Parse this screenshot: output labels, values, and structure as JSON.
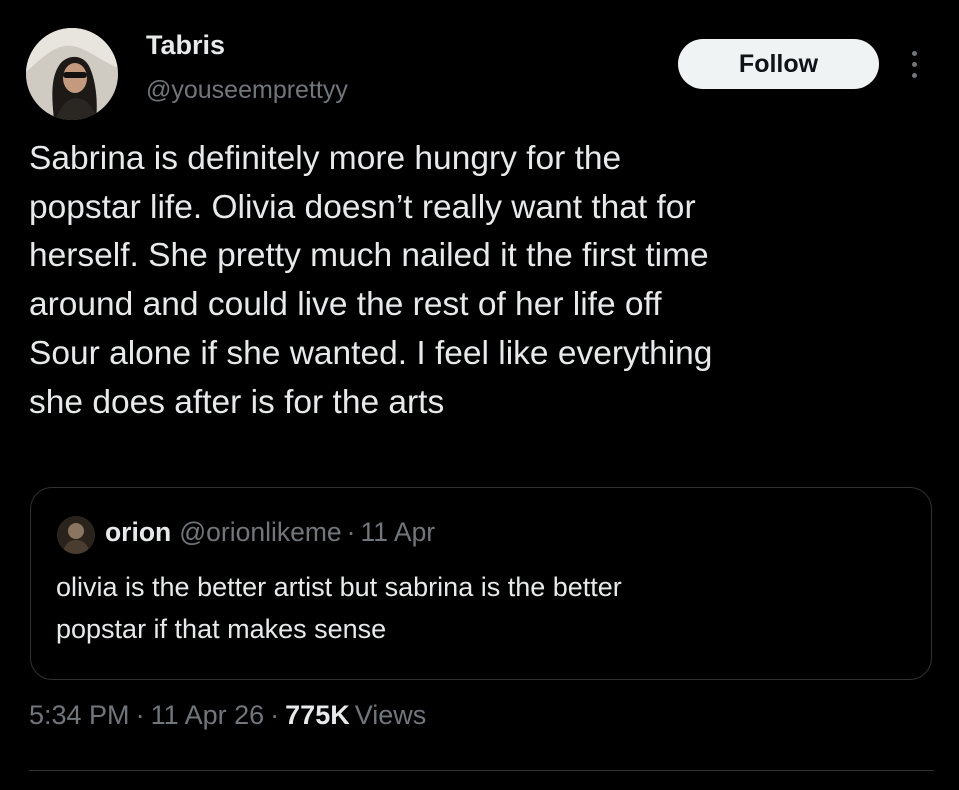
{
  "author": {
    "name": "Tabris",
    "handle": "@youseemprettyy",
    "avatar_icon": "profile-photo"
  },
  "actions": {
    "follow_label": "Follow",
    "more_icon": "more-vertical-icon"
  },
  "tweet": {
    "text_lines": [
      "Sabrina is definitely more hungry for the",
      "popstar life. Olivia doesn’t really want that for",
      "herself. She pretty much nailed it the first time",
      "around and could live the rest of her life off",
      "Sour alone if she wanted. I feel like everything",
      "she does after is for the arts"
    ]
  },
  "quote": {
    "name": "orion",
    "handle": "@orionlikeme",
    "separator": "·",
    "date": "11 Apr",
    "text_lines": [
      "olivia is the better artist but sabrina is the better",
      "popstar if that makes sense"
    ]
  },
  "meta": {
    "time": "5:34 PM",
    "separator": "·",
    "date": "11 Apr 26",
    "views_count": "775K",
    "views_label": "Views"
  },
  "colors": {
    "background": "#000000",
    "text_primary": "#e7e9ea",
    "text_secondary": "#71767b",
    "border": "#2f3336",
    "follow_bg": "#eff3f4"
  }
}
